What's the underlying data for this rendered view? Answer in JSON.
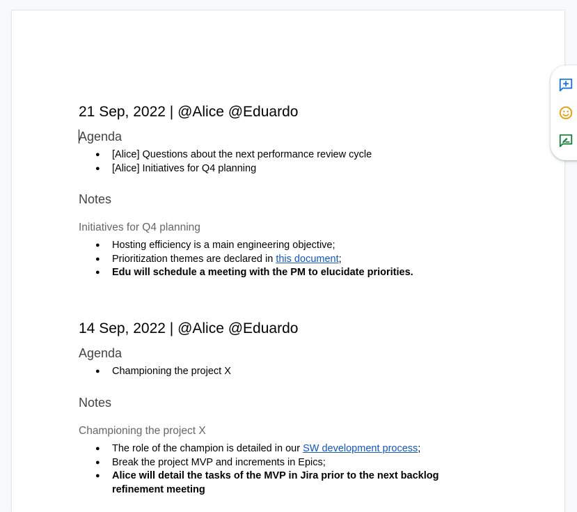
{
  "colors": {
    "link": "#1155cc",
    "add_comment_icon": "#1a73e8",
    "emoji_icon": "#f29900",
    "suggest_icon": "#188038"
  },
  "sections": [
    {
      "title": "21 Sep, 2022 | @Alice @Eduardo",
      "agenda_heading": "Agenda",
      "agenda_items": [
        "[Alice] Questions about the next performance review cycle",
        "[Alice] Initiatives for Q4 planning"
      ],
      "notes_heading": "Notes",
      "subheading": "Initiatives for Q4 planning",
      "notes": {
        "item1": "Hosting efficiency is a main engineering objective;",
        "item2_before": "Prioritization themes are declared in ",
        "item2_link": "this document",
        "item2_after": ";",
        "item3": "Edu will schedule a meeting with the PM to elucidate priorities."
      }
    },
    {
      "title": "14 Sep, 2022 | @Alice @Eduardo",
      "agenda_heading": "Agenda",
      "agenda_items": [
        "Championing the project X"
      ],
      "notes_heading": "Notes",
      "subheading": "Championing the project X",
      "notes": {
        "item1_before": "The role of the champion is detailed in our ",
        "item1_link": "SW development process",
        "item1_after": ";",
        "item2": "Break the project MVP and increments in Epics;",
        "item3_line1": "Alice will detail the tasks of the MVP in Jira prior to the next backlog",
        "item3_line2": "refinement meeting"
      }
    }
  ],
  "bullet_glyph": "●",
  "side_rail": {
    "add_comment_icon": "add-comment-icon",
    "emoji_icon": "emoji-reaction-icon",
    "suggest_edit_icon": "suggest-edit-icon"
  }
}
